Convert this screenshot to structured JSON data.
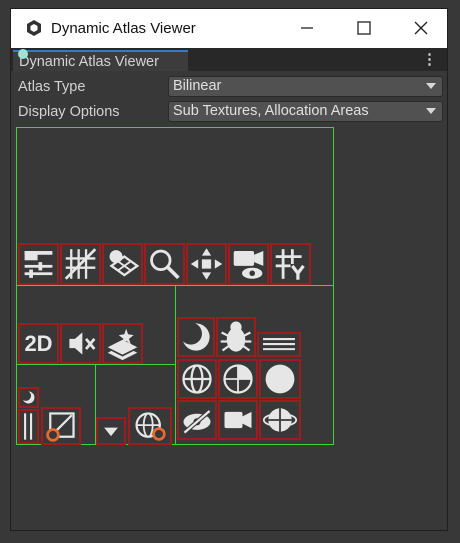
{
  "window": {
    "title": "Dynamic Atlas Viewer",
    "icons": [
      "unity-icon",
      "minimize-icon",
      "maximize-icon",
      "close-icon"
    ]
  },
  "tab": {
    "label": "Dynamic Atlas Viewer",
    "menu_icon": "kebab-menu-icon"
  },
  "fields": {
    "atlas_type": {
      "label": "Atlas Type",
      "value": "Bilinear"
    },
    "display_options": {
      "label": "Display Options",
      "value": "Sub Textures, Allocation Areas"
    }
  },
  "atlas": {
    "allocation_color": "#3cd33c",
    "subtexture_color": "#9b1d1d",
    "icons": [
      "toolbar-settings-icon",
      "grid-snap-icon",
      "layers-icon",
      "search-icon",
      "transform-icon",
      "camera-visibility-icon",
      "grid-y-icon",
      "2d-text-icon",
      "audio-mute-icon",
      "layer-star-icon",
      "moon-icon",
      "bug-icon",
      "horizontal-lines-icon",
      "globe-grid-icon",
      "globe-half-icon",
      "circle-icon",
      "eye-hidden-icon",
      "video-camera-icon",
      "orbit-icon",
      "small-moon-icon",
      "vertical-lines-icon",
      "resize-orange-icon",
      "dropdown-arrow-icon",
      "globe-orange-icon"
    ],
    "text_icon": "2D"
  }
}
